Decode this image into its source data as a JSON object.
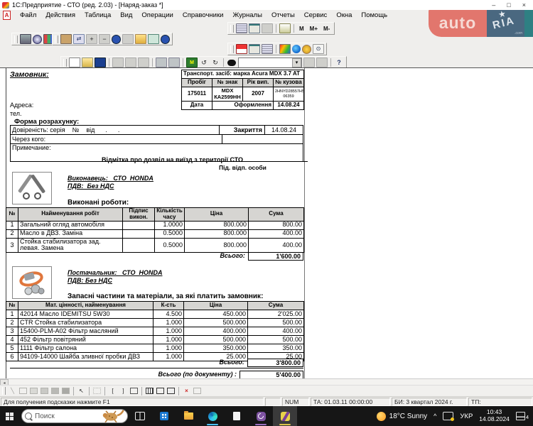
{
  "window": {
    "title": "1С:Предприятие - СТО (ред. 2.03) - [Наряд-заказ *]",
    "controls": {
      "minimize": "–",
      "maximize": "□",
      "close": "×"
    }
  },
  "menu": {
    "icon_letter": "А",
    "items": [
      "Файл",
      "Действия",
      "Таблица",
      "Вид",
      "Операции",
      "Справочники",
      "Журналы",
      "Отчеты",
      "Сервис",
      "Окна",
      "Помощь"
    ]
  },
  "watermark": {
    "auto": "auto",
    "ria": "RIA",
    "star": "★",
    "com": ".com"
  },
  "toolbar": {
    "memory": [
      "М",
      "М+",
      "М-"
    ],
    "monitor": "М",
    "dropdown": "▾",
    "undo": "↺",
    "redo": "↻",
    "help": "?",
    "find_value": ""
  },
  "drawbar": {
    "cursor": "↖",
    "bracket_l": "[",
    "bracket_r": "]",
    "red_x": "×",
    "diag": "╲"
  },
  "doc": {
    "customer_label": "Замовник:",
    "address_label": "Адреса:",
    "phone_label": "тел.",
    "transport": {
      "title": "Транспорт. засіб: марка Acura MDX 3.7 AT",
      "col_mileage": "Пробіг",
      "col_plate": "№ знак",
      "col_year": "Рік вип.",
      "col_vin": "№ кузова",
      "mileage": "175011",
      "plate1": "MDX",
      "plate2": "КА2599НН",
      "year": "2007",
      "vin1": "2HNYD28557H5",
      "vin2": "06359",
      "date_label": "Дата",
      "date_kind": "Оформлення",
      "date_value": "14.08.24"
    },
    "payment_form_label": "Форма розрахунку:",
    "proxy_label": "Довіреність: серія    №    від      .      .",
    "closing_label": "Закриття",
    "closing_date": "14.08.24",
    "via_label": "Через кого:",
    "note_label": "Примечание:",
    "exit_permit_label": "Відмітка про дозвіл на виїзд з території СТО",
    "exit_sign_label": "Під. відп. особи",
    "executor": {
      "label": "Виконавець:   СТО  HONDA",
      "vat": "ПДВ:  Без НДС",
      "works_title": "Виконані роботи:"
    },
    "works_table": {
      "headers": [
        "№",
        "Найменування робіт",
        "Підпис викон.",
        "Кількість часу",
        "Ціна",
        "Сума"
      ],
      "rows": [
        [
          "1",
          "Загальний огляд автомобіля",
          "",
          "1.0000",
          "800.000",
          "800.00"
        ],
        [
          "2",
          "Масло в ДВЗ. Заміна",
          "",
          "0.5000",
          "800.000",
          "400.00"
        ],
        [
          "3",
          "Стойка стабилизатора зад. левая. Замена",
          "",
          "0.5000",
          "800.000",
          "400.00"
        ]
      ],
      "total_label": "Всього:",
      "total": "1'600.00"
    },
    "supplier": {
      "label": "Постачальник:   СТО  HONDA",
      "vat": "ПДВ: Без НДС",
      "parts_title": "Запасні частини та матеріали, за які платить замовник:"
    },
    "parts_table": {
      "headers": [
        "№",
        "Мат. цінності, найменування",
        "К-сть",
        "Ціна",
        "Сума"
      ],
      "rows": [
        [
          "1",
          "42014 Масло IDEMITSU 5W30",
          "4.500",
          "450.000",
          "2'025.00"
        ],
        [
          "2",
          "CTR Стойка стабилизатора",
          "1.000",
          "500.000",
          "500.00"
        ],
        [
          "3",
          "15400-PLM-A02 Фільтр масляний",
          "1.000",
          "400.000",
          "400.00"
        ],
        [
          "4",
          "452 Фільтр повітряний",
          "1.000",
          "500.000",
          "500.00"
        ],
        [
          "5",
          "1111 Фільтр салона",
          "1.000",
          "350.000",
          "350.00"
        ],
        [
          "6",
          "94109-14000 Шайба зливної пробки ДВЗ",
          "1.000",
          "25.000",
          "25.00"
        ]
      ],
      "total_label": "Всього:",
      "total": "3'800.00"
    },
    "doc_total_label": "Всього (по документу) :",
    "doc_total": "5'400.00"
  },
  "statusbar": {
    "hint": "Для получения подсказки нажмите F1",
    "num": "NUM",
    "ta": "ТА: 01.03.11  00:00:00",
    "bi": "БИ: 3 квартал 2024 г.",
    "tp": "ТП:"
  },
  "taskbar": {
    "search_placeholder": "Поиск",
    "weather": "18°C Sunny",
    "chevron": "^",
    "lang": "УКР",
    "time": "10:43",
    "date": "14.08.2024",
    "notif_count": "4"
  }
}
